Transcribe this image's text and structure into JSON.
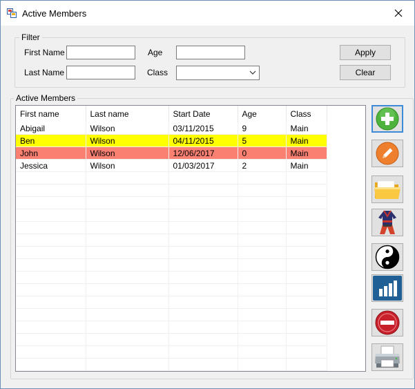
{
  "window": {
    "title": "Active Members"
  },
  "filter": {
    "legend": "Filter",
    "first_name_label": "First Name",
    "last_name_label": "Last Name",
    "age_label": "Age",
    "class_label": "Class",
    "first_name_value": "",
    "last_name_value": "",
    "age_value": "",
    "class_value": "",
    "apply_label": "Apply",
    "clear_label": "Clear"
  },
  "members": {
    "legend": "Active Members",
    "columns": [
      "First name",
      "Last name",
      "Start Date",
      "Age",
      "Class"
    ],
    "rows": [
      {
        "cells": [
          "Abigail",
          "Wilson",
          "03/11/2015",
          "9",
          "Main"
        ],
        "color": "#ffffff"
      },
      {
        "cells": [
          "Ben",
          "Wilson",
          "04/11/2015",
          "5",
          "Main"
        ],
        "color": "#ffff00"
      },
      {
        "cells": [
          "John",
          "Wilson",
          "12/06/2017",
          "0",
          "Main"
        ],
        "color": "#fa8072"
      },
      {
        "cells": [
          "Jessica",
          "Wilson",
          "01/03/2017",
          "2",
          "Main"
        ],
        "color": "#ffffff"
      }
    ],
    "empty_rows": 17
  },
  "toolbar": {
    "buttons": [
      {
        "name": "add-member-button",
        "icon": "plus-icon"
      },
      {
        "name": "edit-member-button",
        "icon": "pencil-icon"
      },
      {
        "name": "open-folder-button",
        "icon": "folder-icon"
      },
      {
        "name": "uniform-button",
        "icon": "uniform-icon"
      },
      {
        "name": "yin-yang-button",
        "icon": "yin-yang-icon"
      },
      {
        "name": "statistics-button",
        "icon": "bar-chart-icon"
      },
      {
        "name": "remove-member-button",
        "icon": "minus-icon"
      },
      {
        "name": "print-button",
        "icon": "printer-icon"
      }
    ]
  },
  "colors": {
    "accent": "#3c8ad8",
    "highlight_yellow": "#ffff00",
    "highlight_salmon": "#fa8072"
  }
}
